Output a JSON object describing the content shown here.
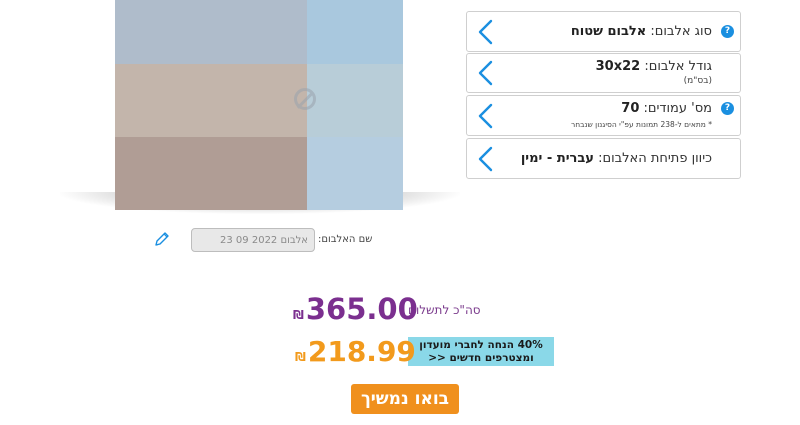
{
  "album_preview": {
    "cells": [
      {
        "name": "photo-top-left",
        "color": "#afbccb"
      },
      {
        "name": "photo-top-right",
        "color": "#a9c8de"
      },
      {
        "name": "photo-middle-left",
        "color": "#c3b5ab"
      },
      {
        "name": "photo-middle-right",
        "color": "#b8cdd8"
      },
      {
        "name": "photo-bottom-left",
        "color": "#b09d95"
      },
      {
        "name": "photo-bottom-right",
        "color": "#b5cde0"
      }
    ]
  },
  "album_name": {
    "label": "שם האלבום:",
    "value": "אלבום 2022 09 23",
    "edit_icon": "pencil-icon"
  },
  "options": [
    {
      "label": "סוג אלבום: ",
      "value": "אלבום שטוח",
      "has_info": true
    },
    {
      "label": "גודל אלבום: ",
      "value": "30x22",
      "sub": "(בס\"מ)",
      "has_info": false
    },
    {
      "label": "מס' עמודים: ",
      "value": "70",
      "note": "* מתאים ל-238 תמונות עפ\"י הסיגנון שנבחר",
      "has_info": true
    },
    {
      "label": "כיוון פתיחת האלבום: ",
      "value": "עברית - ימין",
      "has_info": false
    }
  ],
  "pricing": {
    "total_label": "סה\"כ לתשלום",
    "total_value": "365.00",
    "currency": "₪",
    "promo_text_line1": "40% הנחה לחברי מועדון",
    "promo_text_line2": "ומצטרפים חדשים <<",
    "discount_value": "218.99"
  },
  "continue_button": {
    "label": "בואו נמשיך"
  },
  "colors": {
    "accent_purple": "#7b2f8f",
    "accent_orange": "#f29a1c",
    "button_orange": "#f0901d",
    "promo_bg": "#8ad8e8",
    "info_blue": "#1a8fe0",
    "chevron_blue": "#1a8fe0"
  }
}
